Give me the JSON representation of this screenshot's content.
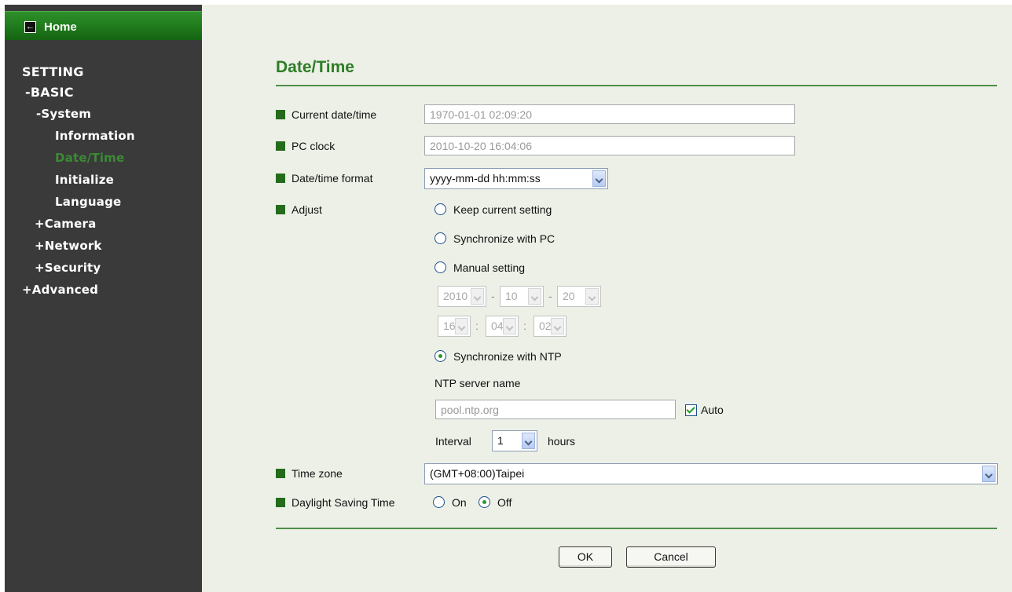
{
  "sidebar": {
    "home_label": "Home",
    "home_icon": "back-arrow-icon",
    "setting": "SETTING",
    "basic": "-BASIC",
    "system": "-System",
    "information": "Information",
    "datetime": "Date/Time",
    "initialize": "Initialize",
    "language": "Language",
    "camera": "+Camera",
    "network": "+Network",
    "security": "+Security",
    "advanced": "+Advanced",
    "active_color": "#3c8a36"
  },
  "main": {
    "title": "Date/Time",
    "current_datetime": {
      "label": "Current date/time",
      "value": "1970-01-01   02:09:20"
    },
    "pc_clock": {
      "label": "PC clock",
      "value": "2010-10-20   16:04:06"
    },
    "format": {
      "label": "Date/time format",
      "value": "yyyy-mm-dd hh:mm:ss"
    },
    "adjust": {
      "label": "Adjust",
      "keep": "Keep current setting",
      "sync_pc": "Synchronize with PC",
      "manual": "Manual setting",
      "year": "2010",
      "month": "10",
      "day": "20",
      "hour": "16",
      "minute": "04",
      "second": "02",
      "date_sep": "-",
      "time_sep": ":",
      "sync_ntp": "Synchronize with NTP",
      "ntp_server_label": "NTP server name",
      "ntp_server_placeholder": "pool.ntp.org",
      "auto_label": "Auto",
      "auto_checked": true,
      "interval_label": "Interval",
      "interval_value": "1",
      "interval_unit": "hours",
      "selected": "sync_ntp"
    },
    "timezone": {
      "label": "Time zone",
      "value": "(GMT+08:00)Taipei"
    },
    "dst": {
      "label": "Daylight Saving Time",
      "on": "On",
      "off": "Off",
      "selected": "off"
    },
    "buttons": {
      "ok": "OK",
      "cancel": "Cancel"
    }
  },
  "colors": {
    "sidebar_bg": "#3a3a3a",
    "home_bar": "#1f7a1c",
    "title_green": "#2e7d26",
    "bullet_green": "#246b1c",
    "content_bg": "#edf0e7"
  }
}
